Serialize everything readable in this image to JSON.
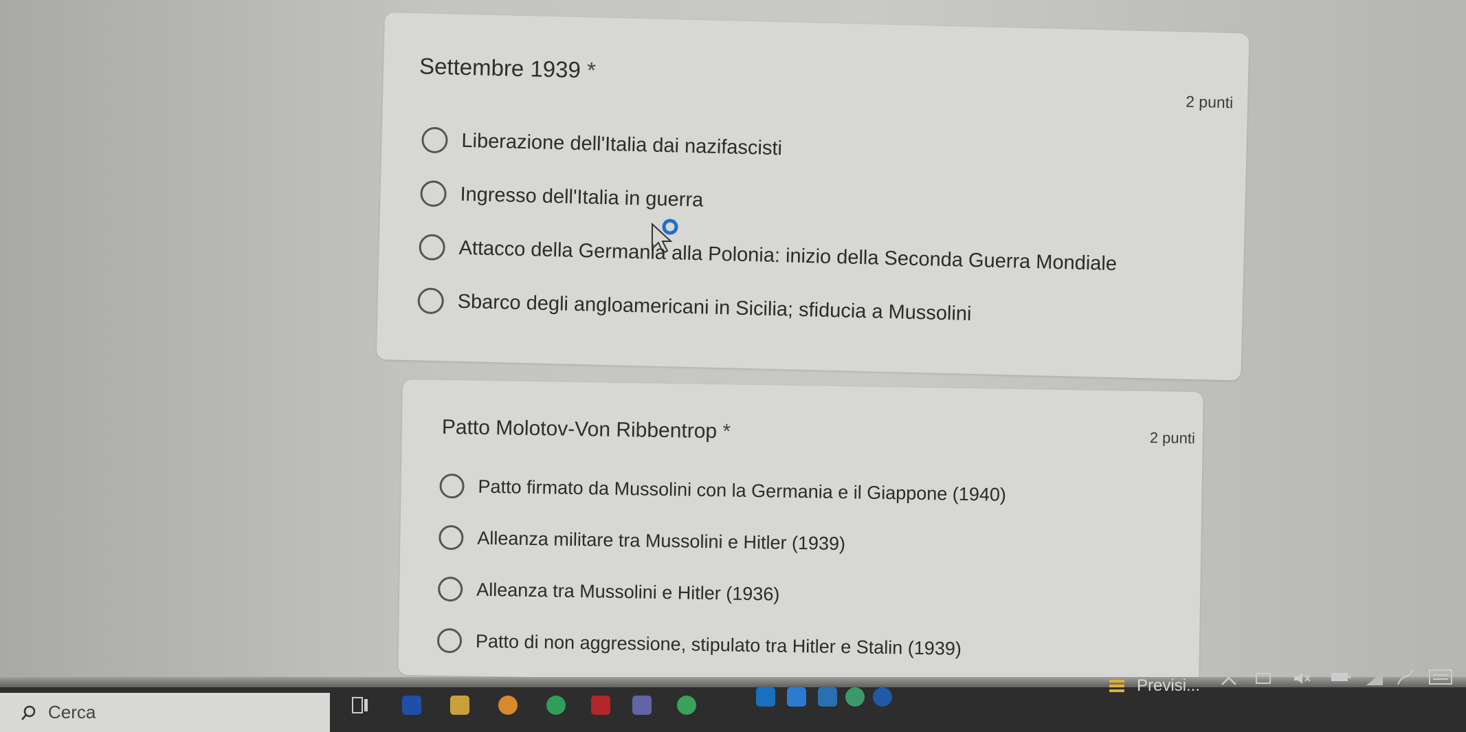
{
  "questions": [
    {
      "title": "Settembre 1939",
      "required_marker": "*",
      "points": "2 punti",
      "options": [
        "Liberazione dell'Italia dai nazifascisti",
        "Ingresso dell'Italia in guerra",
        "Attacco della Germania alla Polonia: inizio della Seconda Guerra Mondiale",
        "Sbarco degli angloamericani in Sicilia; sfiducia a Mussolini"
      ]
    },
    {
      "title": "Patto Molotov-Von Ribbentrop",
      "required_marker": "*",
      "points": "2 punti",
      "options": [
        "Patto firmato da Mussolini con la Germania e il Giappone (1940)",
        "Alleanza militare tra Mussolini e Hitler (1939)",
        "Alleanza tra Mussolini e Hitler (1936)",
        "Patto di non aggressione, stipulato tra Hitler e Stalin (1939)"
      ]
    }
  ],
  "taskbar": {
    "search_label": "Cerca",
    "weather_label": "Previsi..."
  },
  "colors": {
    "card_bg": "#d7d7d4",
    "text": "#2b2b2b",
    "taskbar_bg": "#2d2d2d"
  }
}
